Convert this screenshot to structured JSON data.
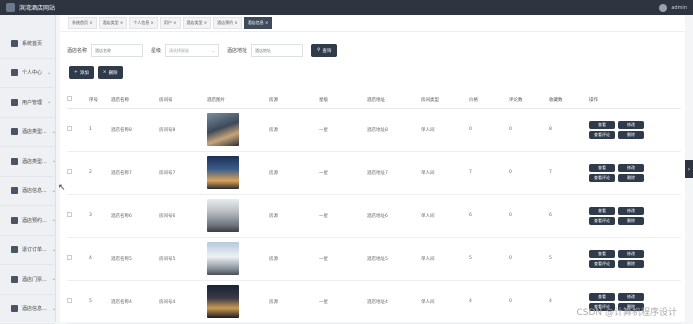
{
  "app": {
    "title": "滨湾酒店网站",
    "user": "admin"
  },
  "sidebar": {
    "items": [
      {
        "label": "系统首页",
        "icon": "home-icon",
        "chevron": ""
      },
      {
        "label": "个人中心",
        "icon": "user-icon",
        "chevron": "⌄"
      },
      {
        "label": "用户管理",
        "icon": "users-icon",
        "chevron": "⌄"
      },
      {
        "label": "酒店类型...",
        "icon": "hotel-icon",
        "chevron": "⌄"
      },
      {
        "label": "酒店类型...",
        "icon": "grid-icon",
        "chevron": "⌄"
      },
      {
        "label": "酒店信息...",
        "icon": "card-icon",
        "chevron": "⌄"
      },
      {
        "label": "酒店预约...",
        "icon": "grid-icon",
        "chevron": "⌄"
      },
      {
        "label": "退订订单...",
        "icon": "shield-icon",
        "chevron": "⌄"
      },
      {
        "label": "酒店门票...",
        "icon": "grid-icon",
        "chevron": "⌄"
      },
      {
        "label": "酒店信息...",
        "icon": "grid-icon",
        "chevron": "⌄"
      }
    ]
  },
  "breadcrumbs": [
    {
      "label": "系统首页 ×",
      "active": false
    },
    {
      "label": "酒店类型 ×",
      "active": false
    },
    {
      "label": "个人信息 ×",
      "active": false
    },
    {
      "label": "用户 ×",
      "active": false
    },
    {
      "label": "酒店类型 ×",
      "active": false
    },
    {
      "label": "酒店预约 ×",
      "active": false
    },
    {
      "label": "酒店信息 ×",
      "active": true
    }
  ],
  "search": {
    "name_label": "酒店名称",
    "name_placeholder": "酒店名称",
    "star_label": "星级",
    "star_placeholder": "请选择星级",
    "address_label": "酒店地址",
    "address_placeholder": "酒店地址",
    "query_button": "查询"
  },
  "actions": {
    "add_button": "添加",
    "delete_button": "删除"
  },
  "table": {
    "headers": [
      "",
      "序号",
      "酒店名称",
      "房间号",
      "酒店图片",
      "房源",
      "星级",
      "酒店地址",
      "房间类型",
      "价格",
      "评论数",
      "收藏数",
      "操作"
    ],
    "rows": [
      {
        "index": "1",
        "name": "酒店名称8",
        "room": "房间号8",
        "source": "房源",
        "star": "一星",
        "address": "酒店地址8",
        "type": "单人间",
        "price": "0",
        "comments": "0",
        "favorites": "8"
      },
      {
        "index": "2",
        "name": "酒店名称7",
        "room": "房间号7",
        "source": "房源",
        "star": "一星",
        "address": "酒店地址7",
        "type": "单人间",
        "price": "7",
        "comments": "0",
        "favorites": "7"
      },
      {
        "index": "3",
        "name": "酒店名称6",
        "room": "房间号6",
        "source": "房源",
        "star": "一星",
        "address": "酒店地址6",
        "type": "单人间",
        "price": "6",
        "comments": "0",
        "favorites": "6"
      },
      {
        "index": "4",
        "name": "酒店名称5",
        "room": "房间号5",
        "source": "房源",
        "star": "一星",
        "address": "酒店地址5",
        "type": "单人间",
        "price": "5",
        "comments": "0",
        "favorites": "5"
      },
      {
        "index": "5",
        "name": "酒店名称4",
        "room": "房间号4",
        "source": "房源",
        "star": "一星",
        "address": "酒店地址4",
        "type": "单人间",
        "price": "4",
        "comments": "0",
        "favorites": "4"
      }
    ],
    "op_labels": {
      "view": "查看",
      "edit": "修改",
      "comments": "查看评论",
      "delete": "删除"
    }
  },
  "watermark": "CSDN @计算机程序设计"
}
